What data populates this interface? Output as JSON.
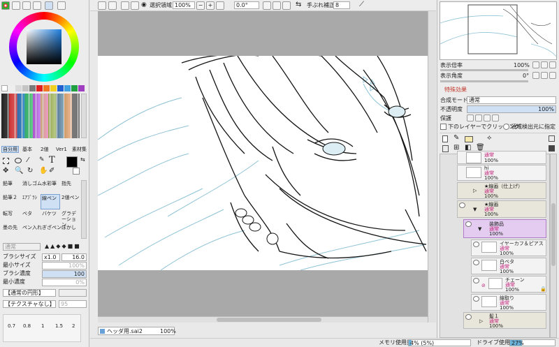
{
  "color_tabs": [
    "color-wheel-icon",
    "rgb-slider-icon",
    "hsv-slider-icon",
    "swatch-icon",
    "scratchpad-icon"
  ],
  "palette_colors": [
    "#ffffff",
    "#eeeeee",
    "#d9d9d9",
    "#c4c4c4",
    "#7a7a7a",
    "#e02020",
    "#f07820",
    "#f0d020",
    "#2060d0",
    "#40a0e0",
    "#20a040",
    "#a040c0"
  ],
  "tool_tabs": [
    "自分用",
    "基本",
    "2値",
    "Ver1",
    "素材集"
  ],
  "tools": [
    "鉛筆",
    "消しゴム",
    "水彩筆",
    "指先",
    "鉛筆２",
    "ｴｱﾌﾞﾗｼ",
    "線ペン",
    "2値ペン",
    "転写",
    "ベタ",
    "バケツ",
    "グラデーション",
    "墨の先",
    "ペン入れ",
    "ぎざペン",
    "ぼかし"
  ],
  "brush_mode": "通常",
  "brush": {
    "size_label": "ブラシサイズ",
    "size_mult": "x1.0",
    "size_value": "16.0",
    "min_size_label": "最小サイズ",
    "min_size_value": "100%",
    "density_label": "ブラシ濃度",
    "density_value": "100",
    "min_density_label": "最小濃度",
    "min_density_value": "0%"
  },
  "shape_dropdown": "【通常の円形】",
  "texture_dropdown": "【テクスチャなし】",
  "texture_value": "95",
  "size_presets": [
    "0.7",
    "0.8",
    "1",
    "1.5",
    "2"
  ],
  "toolbar": {
    "select_label": "選択領域",
    "zoom": "100%",
    "rotation": "0.0°",
    "stabilizer_label": "手ぶれ補正",
    "stabilizer_value": "8"
  },
  "navigator": {
    "zoom_label": "表示倍率",
    "zoom_value": "100%",
    "angle_label": "表示角度",
    "angle_value": "0°"
  },
  "effects_label": "特殊効果",
  "layer_panel": {
    "blend_label": "合成モード",
    "blend_value": "通常",
    "opacity_label": "不透明度",
    "opacity_value": "100%",
    "protect_label": "保護",
    "clip_label": "下のレイヤーでクリッピング",
    "detect_label": "領域検出元に指定"
  },
  "layers": [
    {
      "name": "",
      "mode": "通常",
      "opacity": "100%"
    },
    {
      "name": "hi",
      "mode": "通常",
      "opacity": "100%"
    },
    {
      "name": "★線画（仕上げ）",
      "mode": "通常",
      "opacity": "100%"
    },
    {
      "name": "★線画",
      "mode": "通常",
      "opacity": "100%"
    },
    {
      "name": "装飾品",
      "mode": "通常",
      "opacity": "100%"
    },
    {
      "name": "イヤーカフ＆ピアス",
      "mode": "通常",
      "opacity": "100%"
    },
    {
      "name": "白ベタ",
      "mode": "通常",
      "opacity": "100%"
    },
    {
      "name": "チェーン",
      "mode": "通常",
      "opacity": "100%"
    },
    {
      "name": "線取り",
      "mode": "通常",
      "opacity": "100%"
    },
    {
      "name": "髪１",
      "mode": "通常",
      "opacity": "100%"
    }
  ],
  "document_tab": {
    "name": "ヘッダ用.sai2",
    "zoom": "100%"
  },
  "status": {
    "memory_label": "メモリ使用量",
    "memory_value": "4% (5%)",
    "drive_label": "ドライブ使用量",
    "drive_value": "27%"
  }
}
